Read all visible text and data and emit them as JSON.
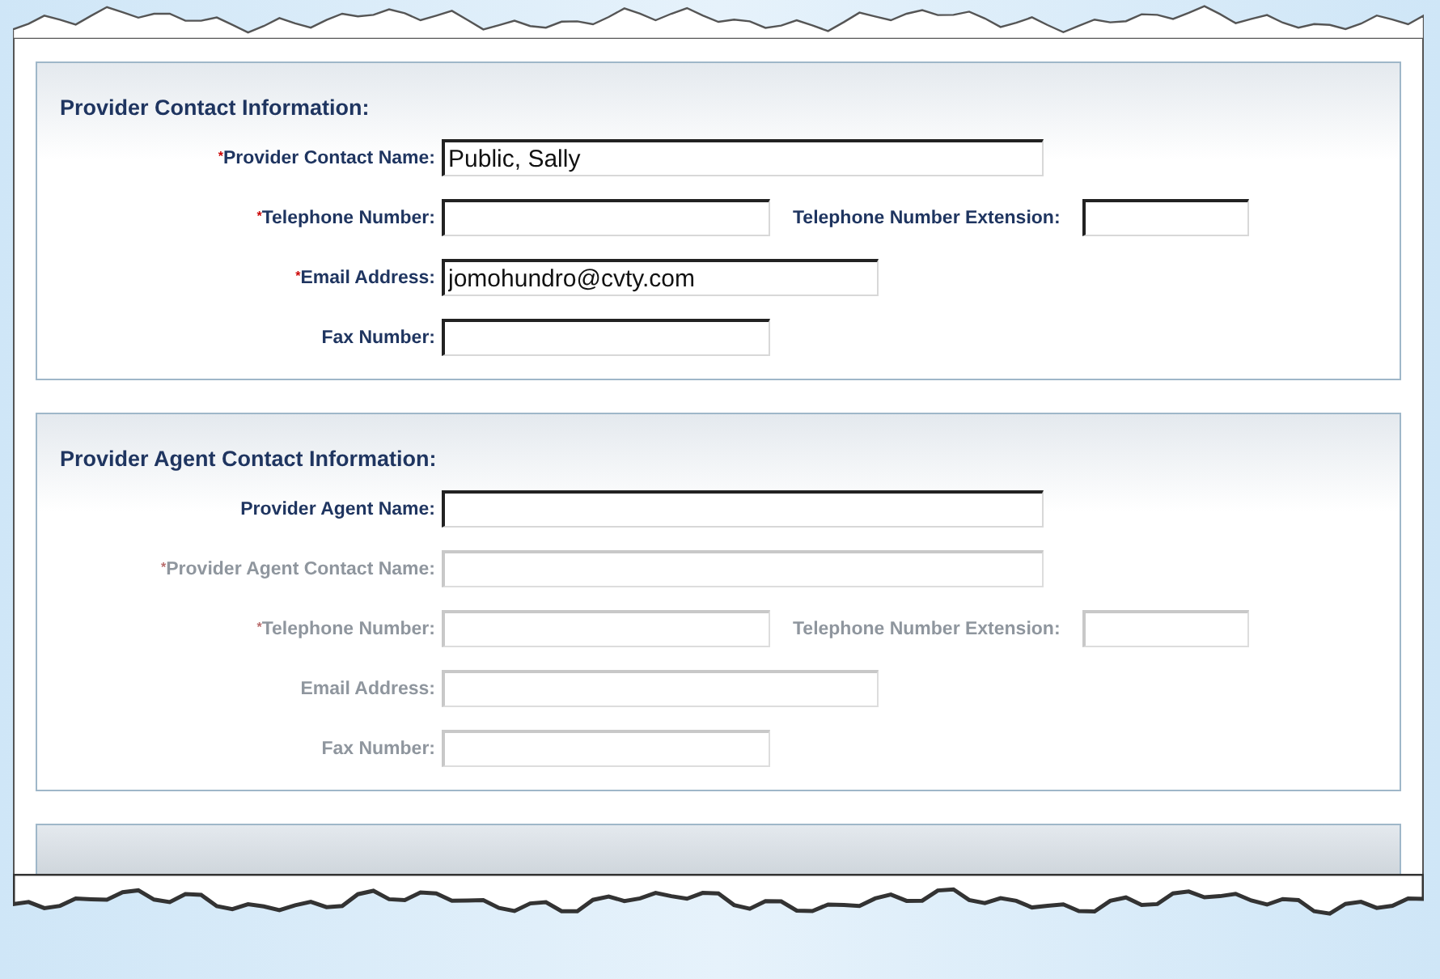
{
  "sections": [
    {
      "title": "Provider Contact Information:",
      "rows": [
        {
          "required_mark": "*",
          "label": "Provider Contact Name:",
          "kind": "name",
          "value": "Public, Sally",
          "disabled": false
        },
        {
          "required_mark": "*",
          "label": "Telephone Number:",
          "kind": "phone",
          "value": "",
          "disabled": false,
          "extension": {
            "label": "Telephone Number Extension:"
          }
        },
        {
          "required_mark": "*",
          "label": "Email Address:",
          "kind": "email",
          "value": "jomohundro@cvty.com",
          "disabled": false
        },
        {
          "label": "Fax Number:",
          "kind": "phone",
          "value": "",
          "disabled": false
        }
      ]
    },
    {
      "title": "Provider Agent Contact Information:",
      "rows": [
        {
          "label": "Provider Agent Name:",
          "kind": "name",
          "value": "",
          "disabled": false
        },
        {
          "required_mark": "*",
          "label": "Provider Agent Contact Name:",
          "kind": "name",
          "value": "",
          "disabled": true
        },
        {
          "required_mark": "*",
          "label": "Telephone Number:",
          "kind": "phone",
          "value": "",
          "disabled": true,
          "extension": {
            "label": "Telephone Number Extension:"
          }
        },
        {
          "label": "Email Address:",
          "kind": "email",
          "value": "",
          "disabled": true
        },
        {
          "label": "Fax Number:",
          "kind": "phone",
          "value": "",
          "disabled": true
        }
      ]
    }
  ]
}
